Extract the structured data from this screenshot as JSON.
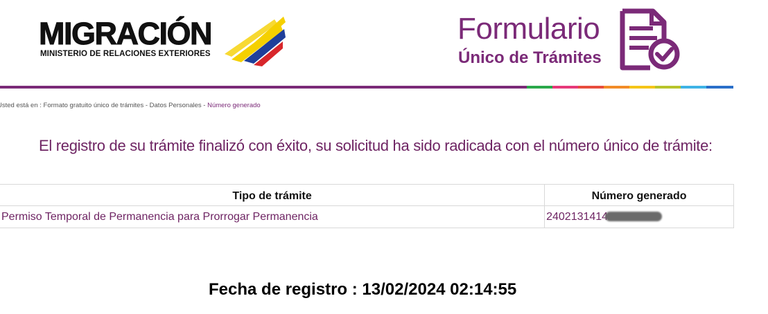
{
  "header": {
    "migracion_logo": {
      "title": "MIGRACIÓN",
      "subtitle": "MINISTERIO DE RELACIONES EXTERIORES"
    },
    "form_logo": {
      "title": "Formulario",
      "subtitle": "Único de Trámites"
    },
    "colors": {
      "brand_purple": "#7b2a78",
      "heading_purple": "#6e2463"
    },
    "colorbar": [
      "#7b2a78",
      "#2aa84a",
      "#e6397a",
      "#e84c3d",
      "#f28c28",
      "#f5c518",
      "#b7c42b",
      "#3fb3e6",
      "#2a6fc9"
    ]
  },
  "breadcrumb": {
    "prefix": "Usted está en : Formato gratuito único de trámites - Datos Personales - ",
    "current": "Número generado"
  },
  "main": {
    "heading": "El registro de su trámite finalizó con éxito, su solicitud ha sido radicada con el número único de trámite:",
    "table": {
      "headers": [
        "Tipo de trámite",
        "Número generado"
      ],
      "rows": [
        {
          "tipo": "Permiso Temporal de Permanencia para Prorrogar Permanencia",
          "numero": "2402131414"
        }
      ]
    },
    "fecha": "Fecha de registro : 13/02/2024 02:14:55"
  }
}
